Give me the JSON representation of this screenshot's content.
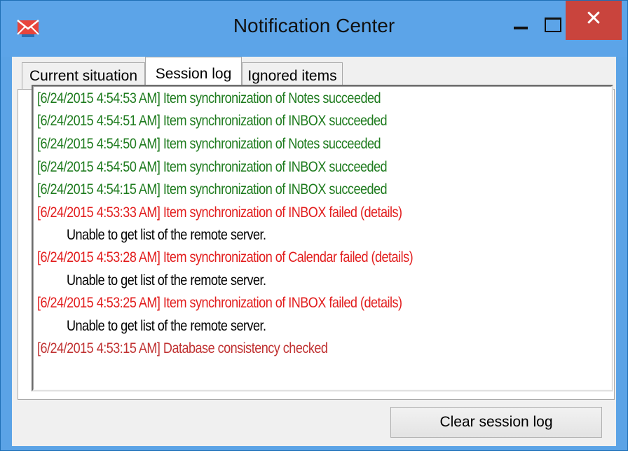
{
  "window": {
    "title": "Notification Center",
    "close_glyph": "✕"
  },
  "tabs": [
    {
      "label": "Current situation",
      "active": false
    },
    {
      "label": "Session log",
      "active": true
    },
    {
      "label": "Ignored items",
      "active": false
    }
  ],
  "log": [
    {
      "text": "[6/24/2015 4:54:53 AM] Item synchronization of Notes succeeded",
      "status": "success"
    },
    {
      "text": "[6/24/2015 4:54:51 AM] Item synchronization of INBOX succeeded",
      "status": "success"
    },
    {
      "text": "[6/24/2015 4:54:50 AM] Item synchronization of Notes succeeded",
      "status": "success"
    },
    {
      "text": "[6/24/2015 4:54:50 AM] Item synchronization of INBOX succeeded",
      "status": "success"
    },
    {
      "text": "[6/24/2015 4:54:15 AM] Item synchronization of INBOX succeeded",
      "status": "success"
    },
    {
      "text": "[6/24/2015 4:53:33 AM] Item synchronization of INBOX failed (details)",
      "status": "failed"
    },
    {
      "text": "Unable to get list of the remote server.",
      "status": "detail"
    },
    {
      "text": "[6/24/2015 4:53:28 AM] Item synchronization of Calendar failed (details)",
      "status": "failed"
    },
    {
      "text": "Unable to get list of the remote server.",
      "status": "detail"
    },
    {
      "text": "[6/24/2015 4:53:25 AM] Item synchronization of INBOX failed (details)",
      "status": "failed"
    },
    {
      "text": "Unable to get list of the remote server.",
      "status": "detail"
    },
    {
      "text": "[6/24/2015 4:53:15 AM] Database consistency checked",
      "status": "info"
    }
  ],
  "colors": {
    "titlebar": "#5ca4e8",
    "close_button": "#c9443d",
    "success": "#1e7b1e",
    "failed": "#e21d1d",
    "info": "#c03232"
  },
  "buttons": {
    "clear_label": "Clear session log"
  },
  "icons": {
    "app": "envelope-alert-icon",
    "minimize": "minimize-icon",
    "maximize": "maximize-icon",
    "close": "close-icon"
  }
}
